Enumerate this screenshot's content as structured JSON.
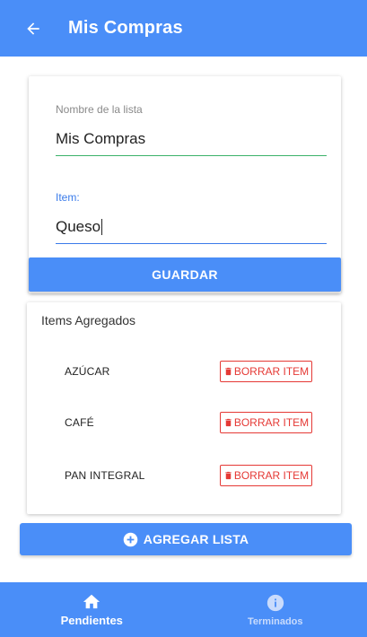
{
  "appbar": {
    "title": "Mis Compras"
  },
  "form": {
    "list_name_label": "Nombre de la lista",
    "list_name_value": "Mis Compras",
    "item_label": "Item:",
    "item_value": "Queso",
    "save_label": "GUARDAR"
  },
  "items_card": {
    "title": "Items Agregados",
    "delete_label": "BORRAR ITEM",
    "items": [
      {
        "name": "AZÚCAR"
      },
      {
        "name": "CAFÉ"
      },
      {
        "name": "PAN INTEGRAL"
      }
    ]
  },
  "add_list": {
    "label": "AGREGAR LISTA"
  },
  "bottom_nav": {
    "items": [
      {
        "label": "Pendientes",
        "icon": "home-icon",
        "active": true
      },
      {
        "label": "Terminados",
        "icon": "info-icon",
        "active": false
      }
    ]
  },
  "colors": {
    "primary": "#4a8ef8",
    "danger": "#e53935",
    "input_underline": "#3bb26a",
    "focus": "#3a7bea"
  }
}
